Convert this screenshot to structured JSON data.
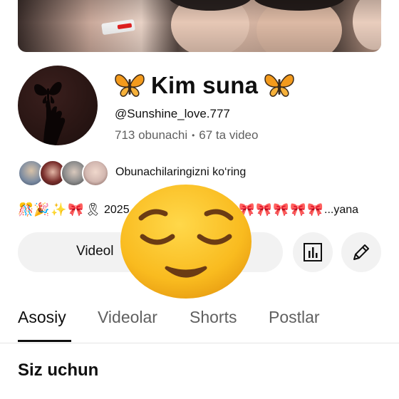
{
  "channel": {
    "name": "Kim suna",
    "handle": "@Sunshine_love.777",
    "subscribers": "713 obunachi",
    "separator": "•",
    "videos": "67 ta video"
  },
  "subscribers_preview": {
    "label": "Obunachilaringizni ko‘ring"
  },
  "description": {
    "visible_text_start": "2025",
    "more": "...yana",
    "emojis_start": [
      "🎊",
      "🎉",
      "✨",
      "🎀",
      "🎗"
    ],
    "emojis_end": [
      "🎀",
      "🎀",
      "🎀",
      "🎀",
      "🎀"
    ]
  },
  "buttons": {
    "videos_partial": "Videol",
    "stats_icon": "analytics-icon",
    "edit_icon": "pencil-icon"
  },
  "tabs": [
    {
      "label": "Asosiy",
      "active": true
    },
    {
      "label": "Videolar",
      "active": false
    },
    {
      "label": "Shorts",
      "active": false
    },
    {
      "label": "Postlar",
      "active": false
    }
  ],
  "section": {
    "title": "Siz uchun"
  },
  "overlay": {
    "icon": "relieved-face-emoji"
  },
  "colors": {
    "text": "#0f0f0f",
    "muted": "#606060",
    "button_bg": "#f2f2f2",
    "divider": "#e5e5e5",
    "emoji_yellow": "#f7b81c"
  }
}
